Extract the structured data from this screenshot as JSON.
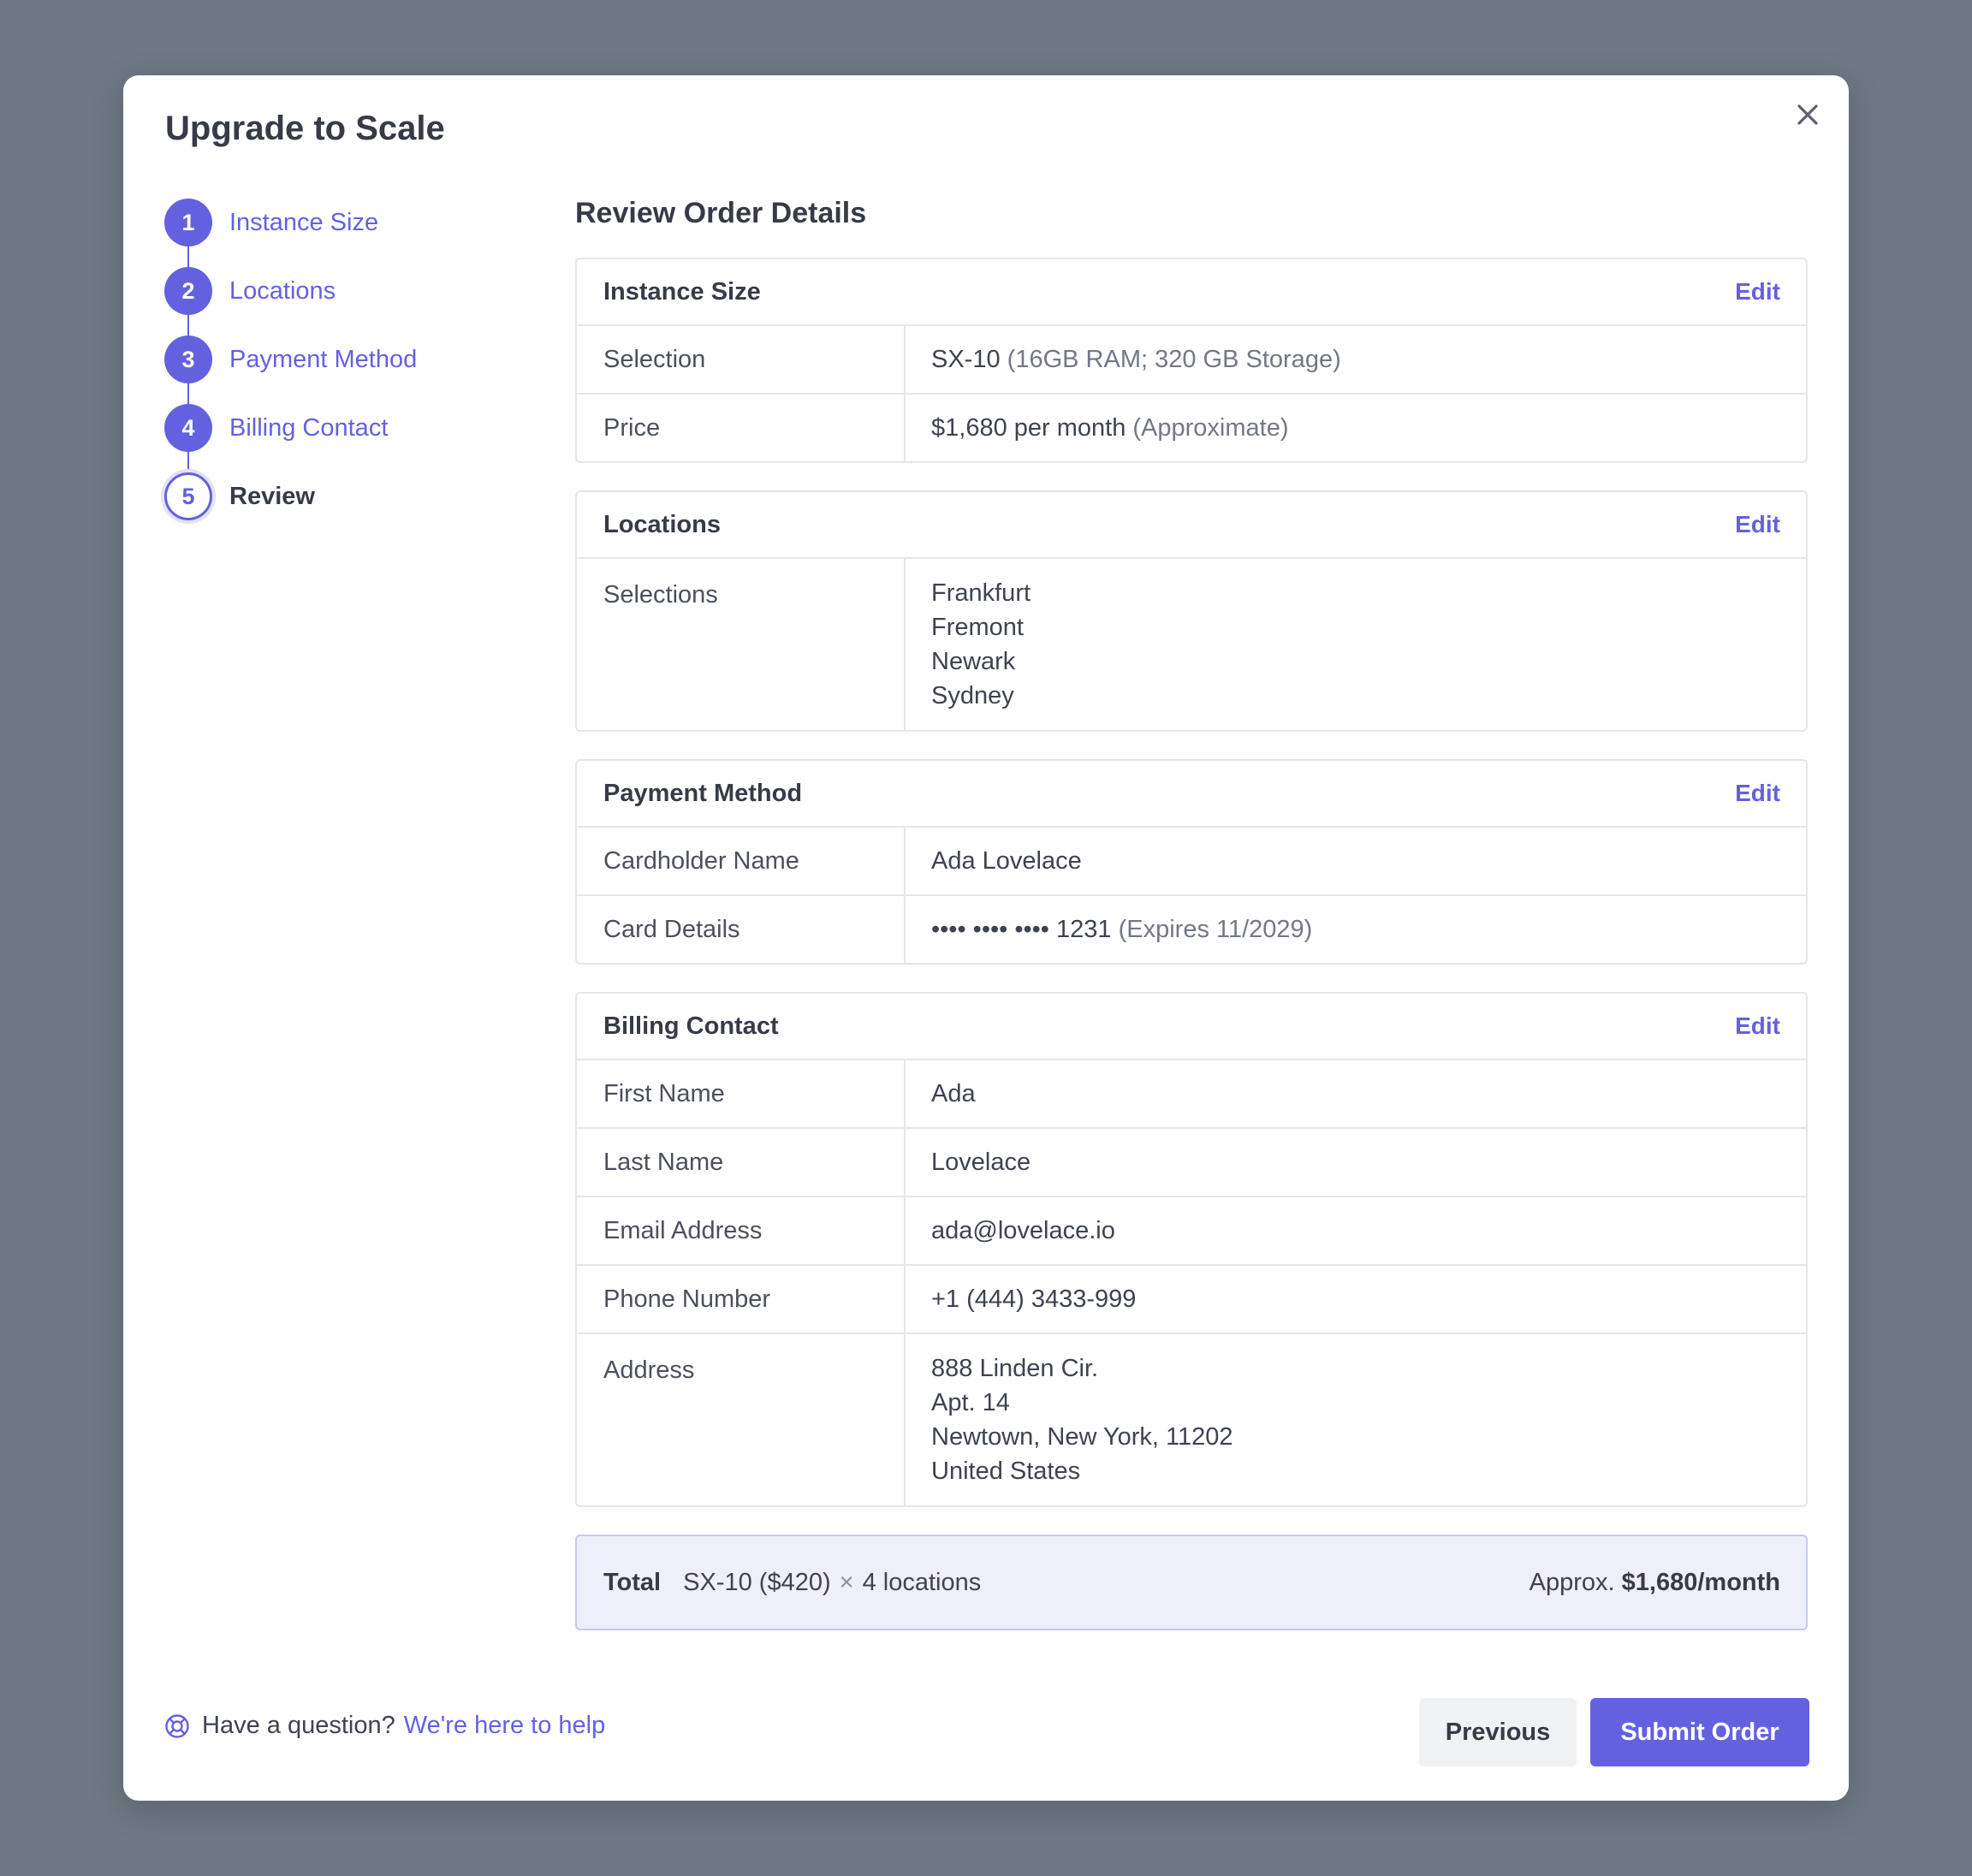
{
  "modal": {
    "title": "Upgrade to Scale"
  },
  "steps": [
    {
      "number": "1",
      "label": "Instance Size"
    },
    {
      "number": "2",
      "label": "Locations"
    },
    {
      "number": "3",
      "label": "Payment Method"
    },
    {
      "number": "4",
      "label": "Billing Contact"
    },
    {
      "number": "5",
      "label": "Review"
    }
  ],
  "content": {
    "title": "Review Order Details"
  },
  "edit_label": "Edit",
  "instance": {
    "title": "Instance Size",
    "selection_label": "Selection",
    "selection_value": "SX-10",
    "selection_detail": "(16GB RAM; 320 GB Storage)",
    "price_label": "Price",
    "price_value": "$1,680 per month",
    "price_detail": "(Approximate)"
  },
  "locations": {
    "title": "Locations",
    "label": "Selections",
    "items": [
      "Frankfurt",
      "Fremont",
      "Newark",
      "Sydney"
    ]
  },
  "payment": {
    "title": "Payment Method",
    "cardholder_label": "Cardholder Name",
    "cardholder_value": "Ada Lovelace",
    "card_label": "Card Details",
    "card_value": "•••• •••• •••• 1231",
    "card_detail": "(Expires 11/2029)"
  },
  "billing": {
    "title": "Billing Contact",
    "first_label": "First Name",
    "first_value": "Ada",
    "last_label": "Last Name",
    "last_value": "Lovelace",
    "email_label": "Email Address",
    "email_value": "ada@lovelace.io",
    "phone_label": "Phone Number",
    "phone_value": "+1 (444) 3433-999",
    "address_label": "Address",
    "address_lines": [
      "888 Linden Cir.",
      "Apt. 14",
      "Newtown, New York, 11202",
      "United States"
    ]
  },
  "total": {
    "label": "Total",
    "base": "SX-10 ($420)",
    "times": "×",
    "multiplier": "4 locations",
    "approx": "Approx.",
    "amount": "$1,680/month"
  },
  "footer": {
    "help_text": "Have a question?",
    "help_link": "We're here to help",
    "previous_label": "Previous",
    "submit_label": "Submit Order"
  },
  "colors": {
    "accent": "#6461e0",
    "backdrop": "#6e7883",
    "total_bg": "#eeeffb"
  }
}
